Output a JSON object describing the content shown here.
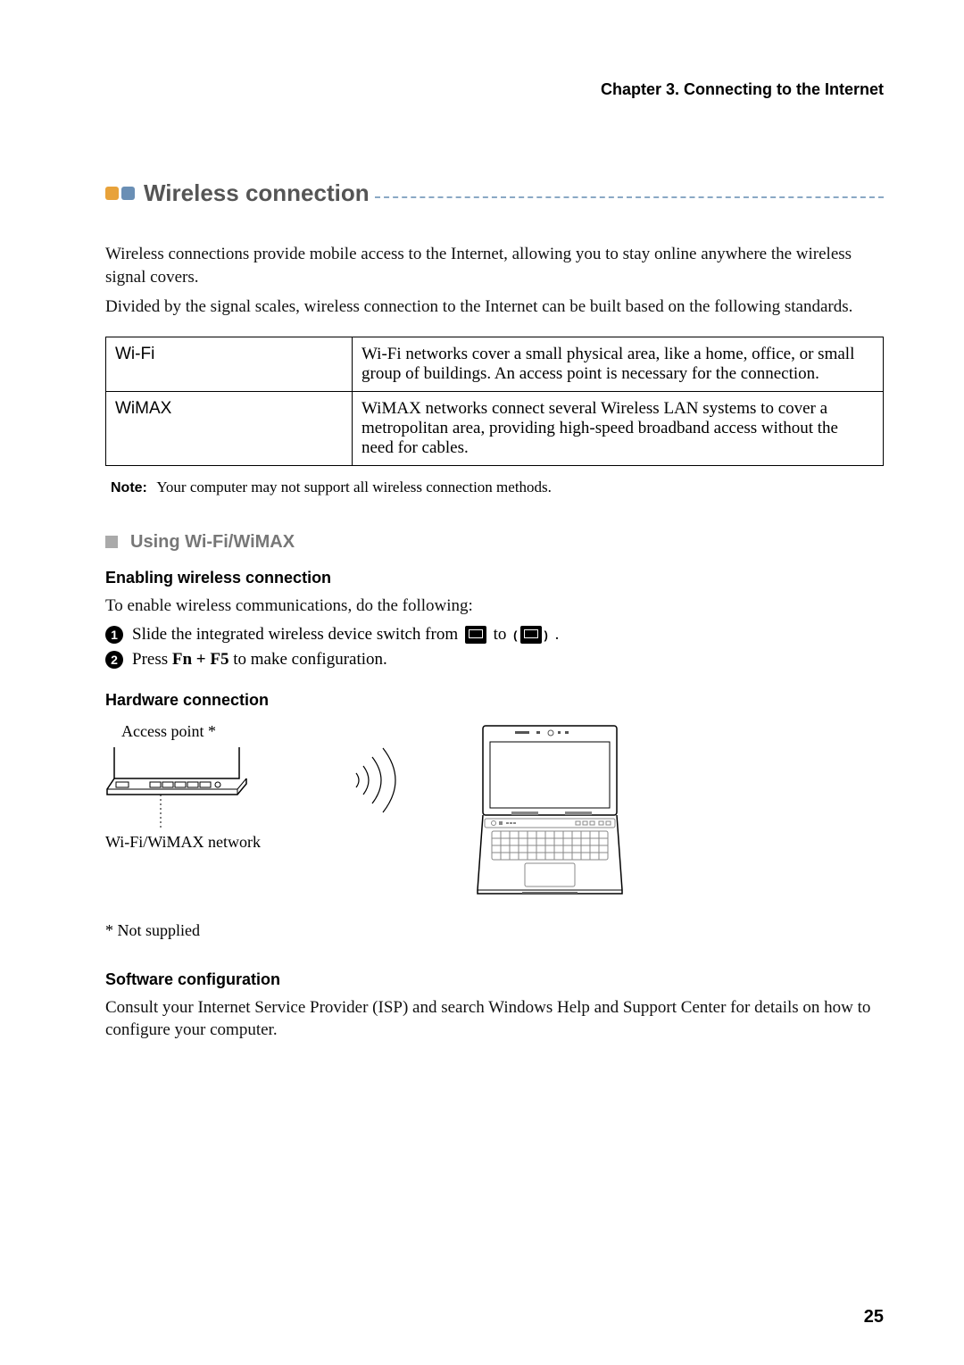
{
  "header": {
    "chapter": "Chapter 3. Connecting to the Internet"
  },
  "section": {
    "title": "Wireless connection",
    "intro1": "Wireless connections provide mobile access to the Internet, allowing you to stay online anywhere the wireless signal covers.",
    "intro2": "Divided by the signal scales, wireless connection to the Internet can be built based on the following standards."
  },
  "table": {
    "rows": [
      {
        "label": "Wi-Fi",
        "desc": "Wi-Fi networks cover a small physical area, like a home, office, or small group of buildings. An access point is necessary for the connection."
      },
      {
        "label": "WiMAX",
        "desc": "WiMAX networks connect several Wireless LAN systems to cover a metropolitan area, providing high-speed broadband access without the need for cables."
      }
    ]
  },
  "note": {
    "label": "Note:",
    "text": "Your computer may not support all wireless connection methods."
  },
  "subsection": {
    "title": "Using Wi-Fi/WiMAX"
  },
  "enabling": {
    "heading": "Enabling wireless connection",
    "intro": "To enable wireless communications, do the following:",
    "step1_pre": "Slide the integrated wireless device switch from ",
    "step1_mid": " to ",
    "step1_post": ".",
    "step2_pre": "Press ",
    "step2_key": "Fn + F5",
    "step2_post": " to make configuration."
  },
  "hardware": {
    "heading": "Hardware connection",
    "ap_label": "Access point *",
    "net_label": "Wi-Fi/WiMAX network",
    "footnote": "* Not supplied"
  },
  "software": {
    "heading": "Software configuration",
    "text": "Consult your Internet Service Provider (ISP) and search Windows Help and Support Center for details on how to configure your computer."
  },
  "page_number": "25"
}
